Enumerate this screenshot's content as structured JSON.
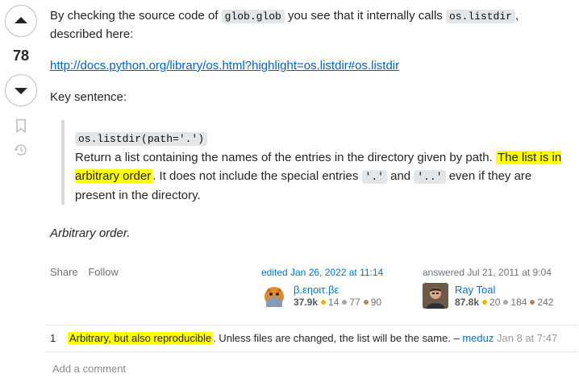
{
  "vote": {
    "count": "78"
  },
  "answer": {
    "intro_before": "By checking the source code of ",
    "intro_code1": "glob.glob",
    "intro_mid": " you see that it internally calls ",
    "intro_code2": "os.listdir",
    "intro_after": ", described here:",
    "link": "http://docs.python.org/library/os.html?highlight=os.listdir#os.listdir",
    "key_sentence": "Key sentence:",
    "quote_code": "os.listdir(path='.')",
    "quote_text1": "Return a list containing the names of the entries in the directory given by path. ",
    "quote_highlight": "The list is in arbitrary order",
    "quote_text2": ". It does not include the special entries ",
    "quote_code_dot": "'.'",
    "quote_and": " and ",
    "quote_code_dotdot": "'..'",
    "quote_text3": " even if they are present in the directory.",
    "closing": "Arbitrary order."
  },
  "actions": {
    "share": "Share",
    "follow": "Follow"
  },
  "edited": {
    "label": "edited Jan 26, 2022 at 11:14",
    "user": "β.εηοιτ.βε",
    "reputation": "37.9k",
    "gold": "14",
    "silver": "77",
    "bronze": "90"
  },
  "answered": {
    "label": "answered Jul 21, 2011 at 9:04",
    "user": "Ray Toal",
    "reputation": "87.8k",
    "gold": "20",
    "silver": "184",
    "bronze": "242"
  },
  "comments": [
    {
      "score": "1",
      "highlight": "Arbitrary, but also reproducible",
      "text": ". Unless files are changed, the list will be the same. – ",
      "user": "meduz",
      "date": "Jan 8 at 7:47"
    }
  ],
  "add_comment": "Add a comment",
  "colors": {
    "link": "#0063bf",
    "highlight": "#ffff00",
    "gold": "#f1b600",
    "silver": "#9fa6ad",
    "bronze": "#ab8a5f"
  },
  "icons": [
    "upvote-icon",
    "downvote-icon",
    "bookmark-icon",
    "history-icon"
  ]
}
